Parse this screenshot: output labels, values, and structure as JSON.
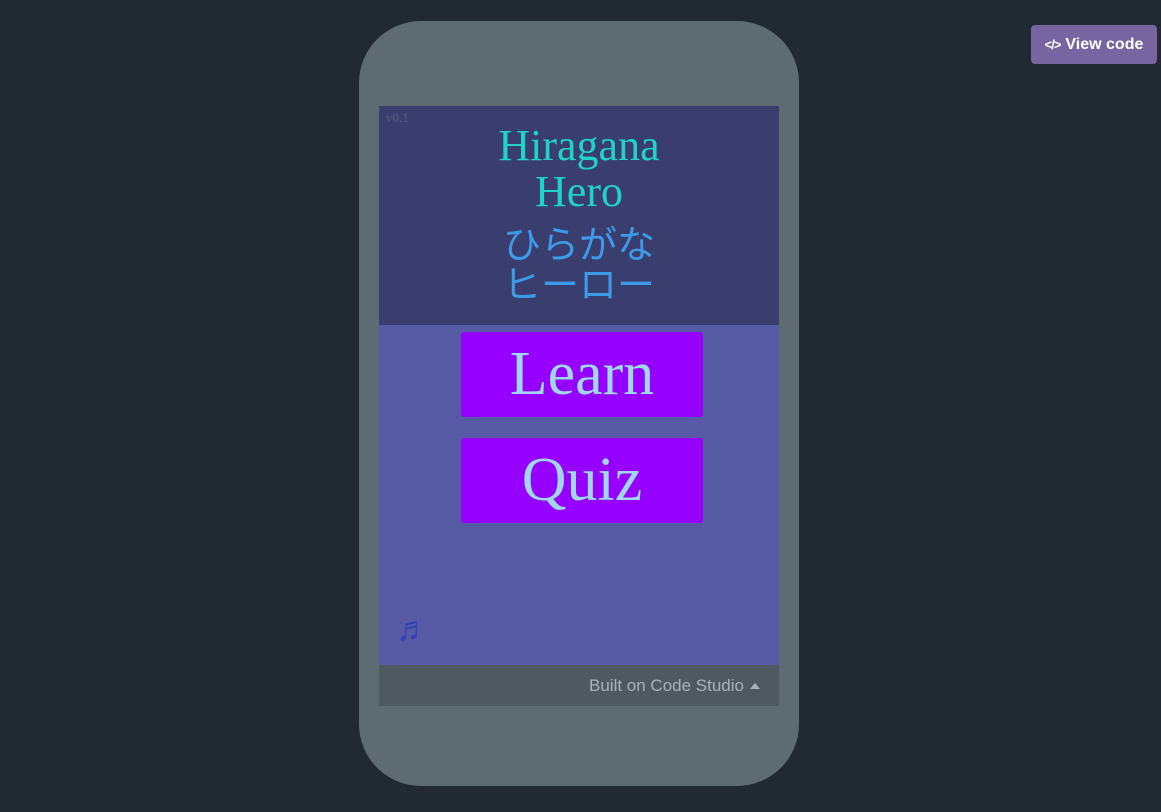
{
  "toolbar": {
    "view_code_label": "View code",
    "view_code_icon": "code-icon"
  },
  "app": {
    "version": "v0.1",
    "title_en_line1": "Hiragana",
    "title_en_line2": "Hero",
    "title_jp_line1": "ひらがな",
    "title_jp_line2": "ヒーロー",
    "learn_label": "Learn",
    "quiz_label": "Quiz",
    "music_icon": "music-note-icon"
  },
  "footer": {
    "text": "Built on Code Studio",
    "caret_icon": "caret-up-icon"
  },
  "colors": {
    "page_background": "#212a33",
    "phone_frame": "#5f6b72",
    "header_panel": "#3a3e6e",
    "body_panel": "#575ba5",
    "title_en": "#1fd3c6",
    "title_jp": "#3d9ae8",
    "button_background": "#9500ff",
    "button_text": "#9ed8ea",
    "music_icon": "#3340b8",
    "view_code_button": "#7665a0",
    "footer_bar": "#4f5961"
  }
}
